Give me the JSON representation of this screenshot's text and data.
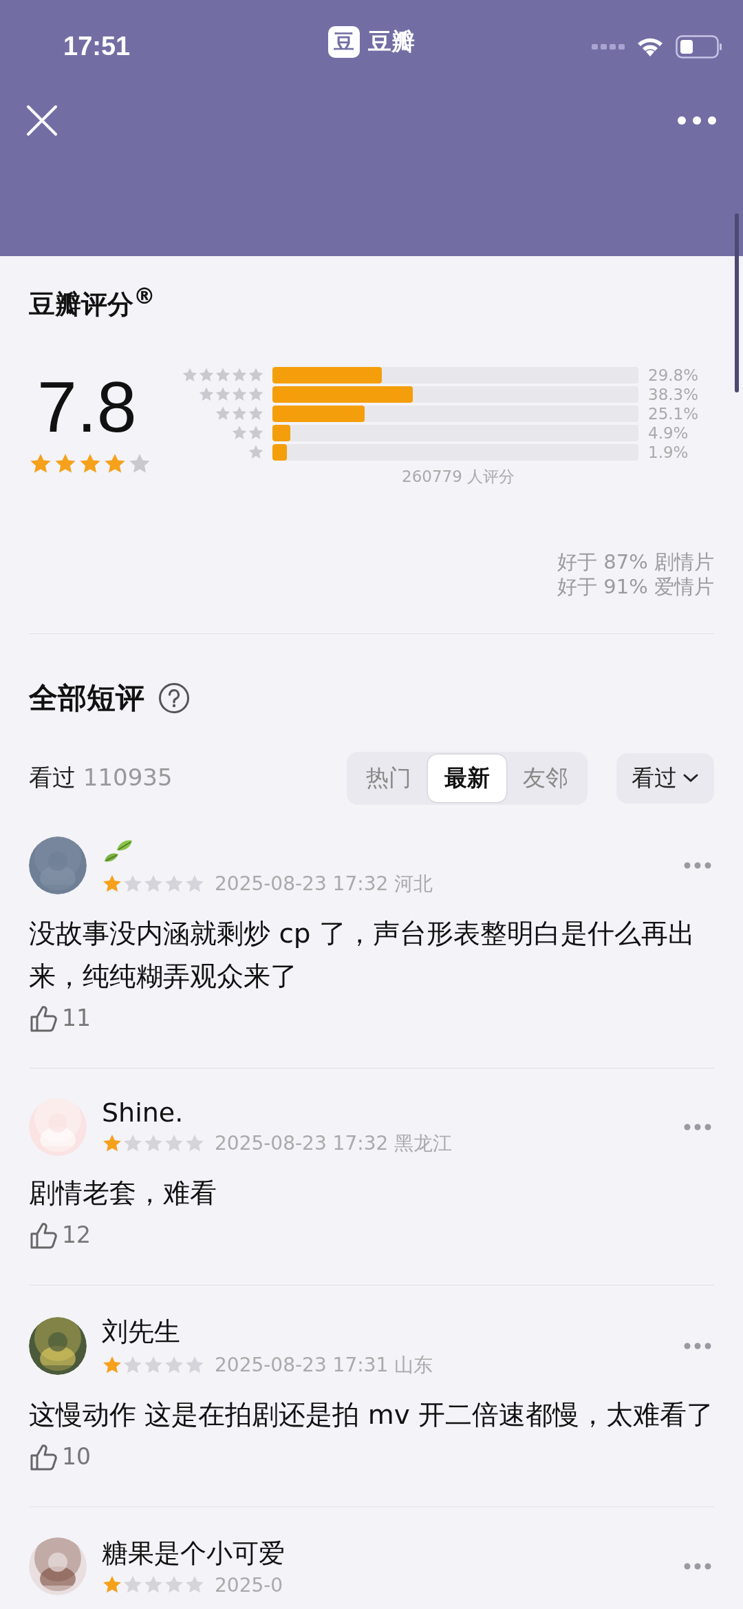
{
  "status_bar": {
    "time": "17:51",
    "app_glyph": "豆",
    "app_name": "豆瓣"
  },
  "rating": {
    "title": "豆瓣评分$^{®}$",
    "score": "7.8",
    "stars": 4,
    "distribution": [
      {
        "level": 0.298,
        "percent": "29.8%"
      },
      {
        "level": 0.383,
        "percent": "38.3%"
      },
      {
        "level": 0.251,
        "percent": "25.1%"
      },
      {
        "level": 0.049,
        "percent": "4.9%"
      },
      {
        "level": 0.019,
        "percent": "1.9%"
      }
    ],
    "count": "260779 人评分",
    "comparisons": [
      "好于 87% 剧情片",
      "好于 91% 爱情片"
    ]
  },
  "reviews": {
    "title": "全部短评",
    "watched_label": "看过",
    "watched_count": "110935",
    "tabs": [
      {
        "label": "热门",
        "selected": false
      },
      {
        "label": "最新",
        "selected": true
      },
      {
        "label": "友邻",
        "selected": false
      }
    ],
    "filter": "看过",
    "comments": [
      {
        "stars": 1,
        "meta": "2025-08-23 17:32 河北",
        "text": "没故事没内涵就剩炒 cp 了，声台形表整明白是什么再出来，纯纯糊弄观众来了",
        "likes": "11"
      },
      {
        "name": "Shine.",
        "stars": 1,
        "meta": "2025-08-23 17:32 黑龙江",
        "text": "剧情老套，难看",
        "likes": "12"
      },
      {
        "name": "刘先生",
        "stars": 1,
        "meta": "2025-08-23 17:31 山东",
        "text": "这慢动作 这是在拍剧还是拍 mv 开二倍速都慢，太难看了",
        "likes": "10"
      },
      {
        "name": "糖果是个小可爱",
        "stars": 1,
        "meta": "2025-0"
      }
    ]
  }
}
